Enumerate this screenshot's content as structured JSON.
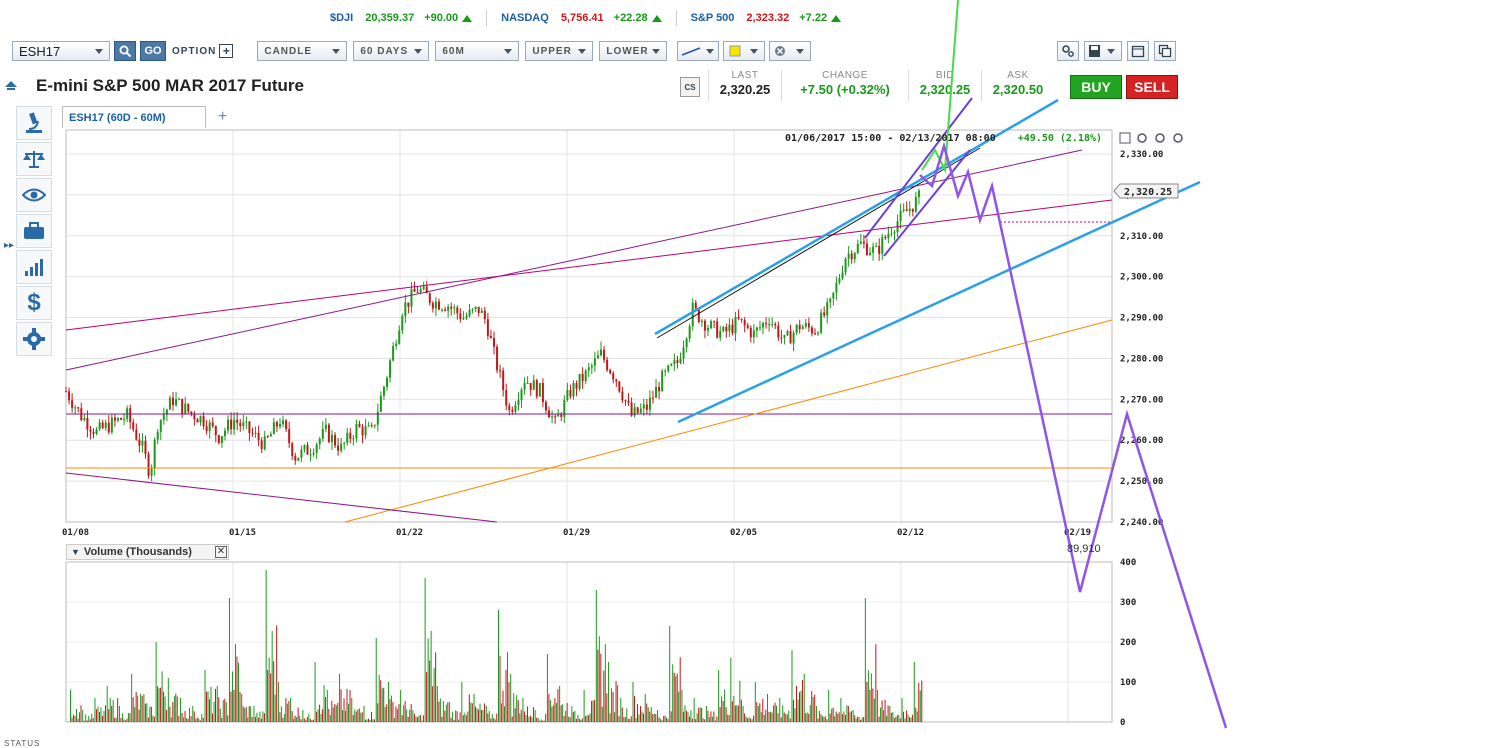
{
  "ticker": [
    {
      "symbol": "$DJI",
      "value": "20,359.37",
      "change": "+90.00",
      "dir": "up"
    },
    {
      "symbol": "NASDAQ",
      "value": "5,756.41",
      "change": "+22.28",
      "dir": "up"
    },
    {
      "symbol": "S&P 500",
      "value": "2,323.32",
      "change": "+7.22",
      "dir": "up"
    }
  ],
  "toolbar": {
    "symbol": "ESH17",
    "go": "GO",
    "option": "OPTION",
    "chart_type": "CANDLE",
    "range": "60 DAYS",
    "interval": "60M",
    "upper": "UPPER",
    "lower": "LOWER"
  },
  "instrument": {
    "title": "E-mini S&P 500 MAR 2017 Future"
  },
  "quote": {
    "last_label": "LAST",
    "last": "2,320.25",
    "change_label": "CHANGE",
    "change": "+7.50 (+0.32%)",
    "bid_label": "BID",
    "bid": "2,320.25",
    "ask_label": "ASK",
    "ask": "2,320.50"
  },
  "actions": {
    "buy": "BUY",
    "sell": "SELL"
  },
  "sidebar": [
    "microscope-icon",
    "scale-icon",
    "eye-icon",
    "briefcase-icon",
    "bar-growth-icon",
    "dollar-icon",
    "gear-icon"
  ],
  "tab": {
    "label": "ESH17 (60D - 60M)",
    "plus": "+"
  },
  "chart": {
    "range_text": "01/06/2017 15:00 - 02/13/2017 08:00",
    "range_change": "+49.50 (2.18%)",
    "last_price_label": "2,320.25",
    "volume_title": "Volume (Thousands)",
    "volume_last": "89,910",
    "status": "STATUS"
  },
  "chart_data": {
    "type": "candlestick",
    "price_ylim": [
      2240,
      2330
    ],
    "price_ticks": [
      "2,330.00",
      "2,320.00",
      "2,310.00",
      "2,300.00",
      "2,290.00",
      "2,280.00",
      "2,270.00",
      "2,260.00",
      "2,250.00",
      "2,240.00"
    ],
    "date_ticks": [
      "01/08",
      "01/15",
      "01/22",
      "01/29",
      "02/05",
      "02/12",
      "02/19"
    ],
    "volume_ylim": [
      0,
      400
    ],
    "volume_ticks": [
      "400",
      "300",
      "200",
      "100",
      "0"
    ],
    "last_price": 2320.25,
    "price_path": [
      [
        0,
        2272
      ],
      [
        2,
        2266
      ],
      [
        4,
        2262
      ],
      [
        6,
        2264
      ],
      [
        8,
        2266
      ],
      [
        10,
        2258
      ],
      [
        11,
        2252
      ],
      [
        12,
        2264
      ],
      [
        14,
        2270
      ],
      [
        16,
        2267
      ],
      [
        18,
        2265
      ],
      [
        20,
        2261
      ],
      [
        22,
        2265
      ],
      [
        24,
        2262
      ],
      [
        26,
        2259
      ],
      [
        28,
        2265
      ],
      [
        30,
        2256
      ],
      [
        32,
        2258
      ],
      [
        34,
        2262
      ],
      [
        36,
        2258
      ],
      [
        38,
        2263
      ],
      [
        40,
        2262
      ],
      [
        42,
        2276
      ],
      [
        44,
        2292
      ],
      [
        46,
        2297
      ],
      [
        48,
        2294
      ],
      [
        50,
        2293
      ],
      [
        52,
        2290
      ],
      [
        54,
        2292
      ],
      [
        55,
        2289
      ],
      [
        56,
        2281
      ],
      [
        58,
        2267
      ],
      [
        60,
        2275
      ],
      [
        62,
        2272
      ],
      [
        64,
        2264
      ],
      [
        66,
        2272
      ],
      [
        68,
        2276
      ],
      [
        70,
        2281
      ],
      [
        72,
        2275
      ],
      [
        74,
        2266
      ],
      [
        76,
        2268
      ],
      [
        78,
        2275
      ],
      [
        80,
        2279
      ],
      [
        82,
        2292
      ],
      [
        84,
        2288
      ],
      [
        86,
        2286
      ],
      [
        88,
        2289
      ],
      [
        90,
        2286
      ],
      [
        92,
        2290
      ],
      [
        94,
        2284
      ],
      [
        96,
        2288
      ],
      [
        98,
        2287
      ],
      [
        100,
        2293
      ],
      [
        102,
        2305
      ],
      [
        104,
        2308
      ],
      [
        106,
        2306
      ],
      [
        108,
        2312
      ],
      [
        110,
        2316
      ],
      [
        112,
        2320
      ]
    ],
    "volume_heights": [
      80,
      30,
      60,
      90,
      40,
      120,
      70,
      200,
      110,
      60,
      40,
      130,
      90,
      310,
      70,
      40,
      380,
      100,
      60,
      30,
      150,
      80,
      120,
      60,
      40,
      210,
      100,
      80,
      30,
      360,
      90,
      50,
      100,
      70,
      40,
      280,
      120,
      60,
      30,
      170,
      90,
      40,
      80,
      330,
      150,
      60,
      100,
      70,
      30,
      240,
      80,
      60,
      40,
      130,
      160,
      40,
      100,
      70,
      60,
      180,
      120,
      40,
      80,
      60,
      30,
      310,
      80,
      40,
      60,
      150
    ]
  }
}
